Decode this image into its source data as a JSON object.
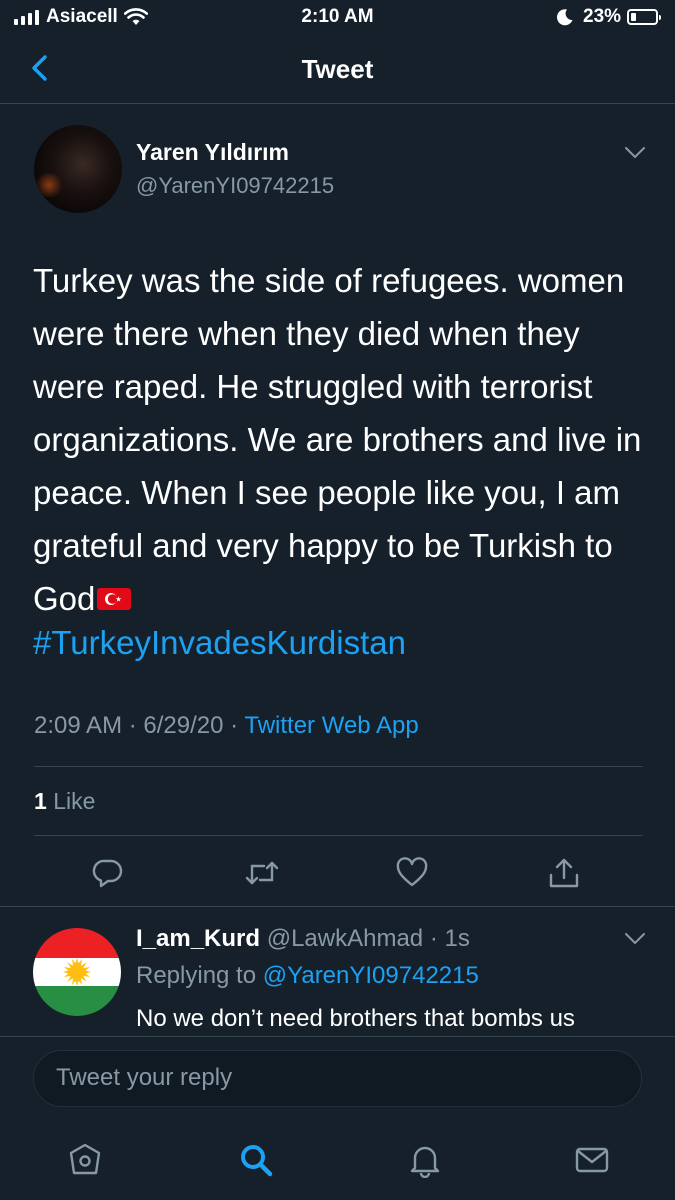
{
  "status_bar": {
    "carrier": "Asiacell",
    "time": "2:10 AM",
    "battery_text": "23%",
    "battery_level": 0.23,
    "icons": [
      "signal-icon",
      "wifi-icon",
      "moon-icon",
      "battery-icon"
    ]
  },
  "nav": {
    "title": "Tweet",
    "back_icon": "chevron-left-icon"
  },
  "tweet": {
    "author_name": "Yaren Yıldırım",
    "author_handle": "@YarenYI09742215",
    "text": "Turkey was the side of refugees. women were there when they died when they were raped. He struggled with terrorist organizations. We are brothers and live in peace. When I see people like you, I am grateful and very happy to be Turkish to God",
    "hashtag": "#TurkeyInvadesKurdistan",
    "time": "2:09 AM",
    "date": "6/29/20",
    "source": "Twitter Web App",
    "separator": " · ",
    "like_count": "1",
    "like_label": "Like",
    "actions": [
      "reply-icon",
      "retweet-icon",
      "like-icon",
      "share-icon"
    ]
  },
  "reply": {
    "name": "I_am_Kurd",
    "handle": "@LawkAhmad",
    "age": "1s",
    "replying_prefix": "Replying to ",
    "replying_to": "@YarenYI09742215",
    "text": "No we don’t need brothers that bombs us"
  },
  "composer": {
    "placeholder": "Tweet your reply",
    "value": ""
  },
  "tab_bar": {
    "items": [
      "home-icon",
      "search-icon",
      "notifications-icon",
      "messages-icon"
    ],
    "active": "search-icon"
  },
  "colors": {
    "background": "#15202b",
    "accent": "#1da1f2",
    "secondary_text": "#8899a6",
    "divider": "#38444d"
  }
}
